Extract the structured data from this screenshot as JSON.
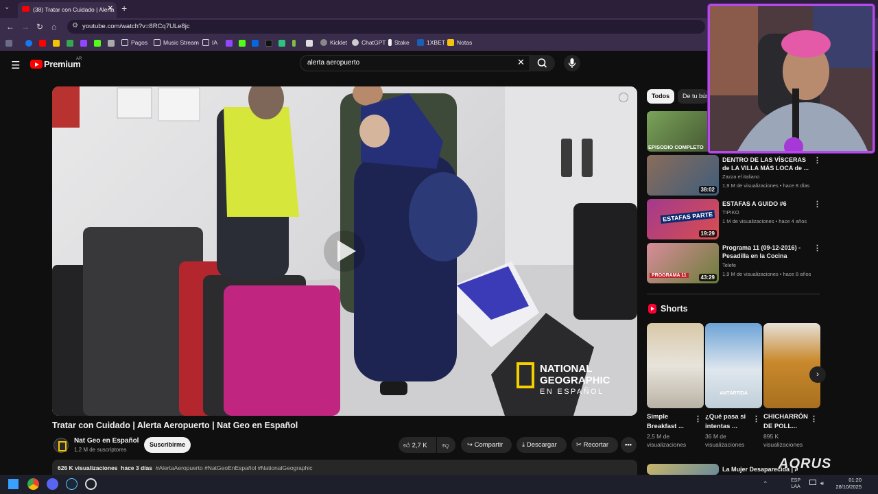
{
  "browser": {
    "tab_title": "(38) Tratar con Cuidado | Alerta",
    "url": "youtube.com/watch?v=8RCq7ULe8jc",
    "bookmarks": [
      "Pagos",
      "Music Stream",
      "IA",
      "Kicklet",
      "ChatGPT",
      "Stake",
      "1XBET",
      "Notas"
    ]
  },
  "youtube": {
    "brand": "Premium",
    "country": "AR",
    "search_query": "alerta aeropuerto"
  },
  "video": {
    "title": "Tratar con Cuidado | Alerta Aeropuerto | Nat Geo en Español",
    "channel": "Nat Geo en Español",
    "subscribers": "1,2 M de suscriptores",
    "subscribe_label": "Suscribirme",
    "likes": "2,7 K",
    "share_label": "Compartir",
    "download_label": "Descargar",
    "clip_label": "Recortar",
    "views": "626 K visualizaciones",
    "age": "hace 3 días",
    "tags": "#AlertaAeropuerto #NatGeoEnEspañol #NationalGeographic",
    "watermark_line1": "NATIONAL",
    "watermark_line2": "GEOGRAPHIC",
    "watermark_line3": "EN ESPAÑOL"
  },
  "chips": {
    "all": "Todos",
    "related": "De tu búsqueda"
  },
  "related": [
    {
      "title": "",
      "channel": "",
      "meta": "",
      "duration": "",
      "badge": "EPISODIO COMPLETO"
    },
    {
      "title": "DENTRO DE LAS VÍSCERAS de LA VILLA MÁS LOCA de ...",
      "channel": "Zazza el italiano",
      "meta": "1,9 M de visualizaciones • hace 8 días",
      "duration": "38:02"
    },
    {
      "title": "ESTAFAS A GUIDO #6",
      "channel": "TIPIKO",
      "meta": "1 M de visualizaciones • hace 4 años",
      "duration": "19:29",
      "badge": "ESTAFAS PARTE"
    },
    {
      "title": "Programa 11 (09-12-2016) - Pesadilla en la Cocina",
      "channel": "Telefe",
      "meta": "1,9 M de visualizaciones • hace 8 años",
      "duration": "43:29",
      "badge": "PROGRAMA 11"
    },
    {
      "title": "La Mujer Desaparecida | Alerta",
      "channel": "",
      "meta": "",
      "duration": ""
    }
  ],
  "shorts": {
    "heading": "Shorts",
    "items": [
      {
        "title": "Simple Breakfast ...",
        "views": "2,5 M de visualizaciones"
      },
      {
        "title": "¿Qué pasa si intentas ...",
        "views": "36 M de visualizaciones",
        "overlay": "ANTÁRTIDA"
      },
      {
        "title": "CHICHARRÓN DE POLL...",
        "views": "895 K visualizaciones"
      }
    ]
  },
  "taskbar": {
    "lang": "ESP",
    "layout": "LAA",
    "time": "01:20",
    "date": "28/10/2025",
    "overlay_brand": "AORUS"
  },
  "colors": {
    "accent_red": "#ff0000",
    "webcam_border": "#b44be6",
    "chrome_bg": "#3a2d4c"
  }
}
